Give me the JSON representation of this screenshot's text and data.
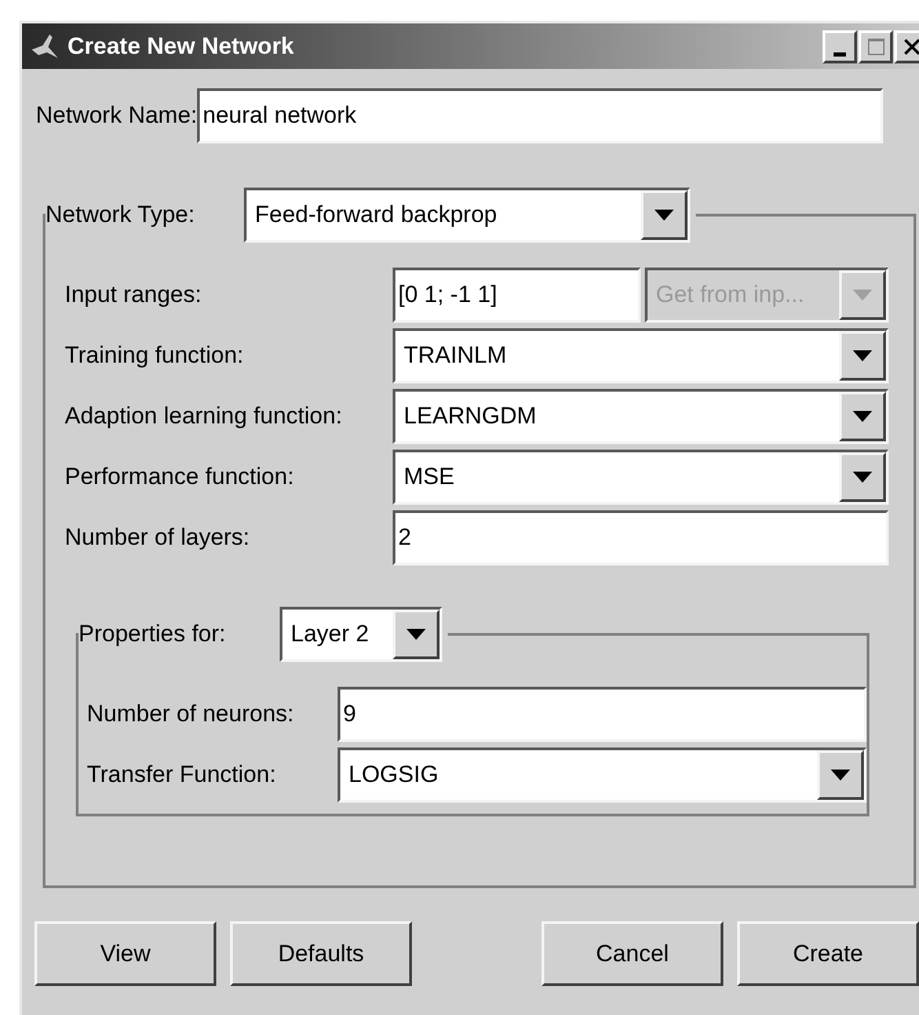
{
  "window": {
    "title": "Create New Network"
  },
  "network_name": {
    "label": "Network Name:",
    "value": "neural network"
  },
  "network_type": {
    "label": "Network Type:",
    "value": "Feed-forward backprop"
  },
  "parameters": [
    {
      "kind": "field_with_combo",
      "label": "Input ranges:",
      "value": "[0 1; -1 1]",
      "combo": {
        "value": "Get from inp...",
        "disabled": true
      }
    },
    {
      "kind": "combo",
      "label": "Training function:",
      "value": "TRAINLM"
    },
    {
      "kind": "combo",
      "label": "Adaption learning function:",
      "value": "LEARNGDM"
    },
    {
      "kind": "combo",
      "label": "Performance function:",
      "value": "MSE"
    },
    {
      "kind": "field",
      "label": "Number of layers:",
      "value": "2"
    }
  ],
  "layer_properties": {
    "label": "Properties for:",
    "value": "Layer 2",
    "parameters": [
      {
        "kind": "field",
        "label": "Number of neurons:",
        "value": "9"
      },
      {
        "kind": "combo",
        "label": "Transfer Function:",
        "value": "LOGSIG"
      }
    ]
  },
  "buttons": [
    "View",
    "Defaults",
    "Cancel",
    "Create"
  ]
}
